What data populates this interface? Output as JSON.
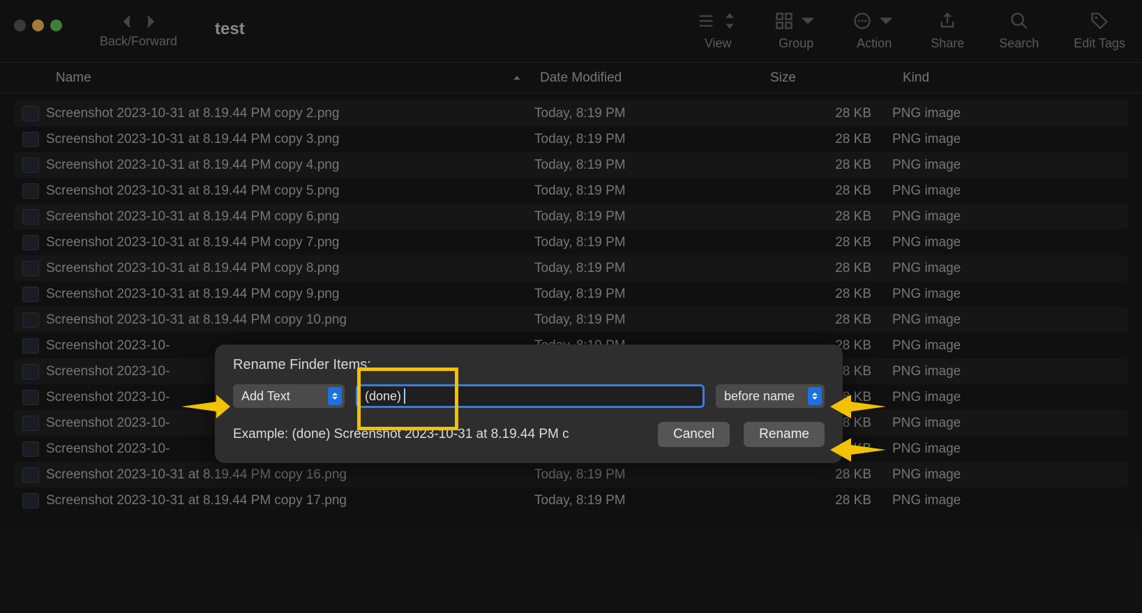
{
  "toolbar": {
    "nav_label": "Back/Forward",
    "title": "test",
    "view_label": "View",
    "group_label": "Group",
    "action_label": "Action",
    "share_label": "Share",
    "search_label": "Search",
    "tags_label": "Edit Tags"
  },
  "columns": {
    "name": "Name",
    "date": "Date Modified",
    "size": "Size",
    "kind": "Kind"
  },
  "date_value": "Today, 8:19 PM",
  "size_value": "28 KB",
  "kind_value": "PNG image",
  "files": [
    "Screenshot 2023-10-31 at 8.19.44 PM copy 2.png",
    "Screenshot 2023-10-31 at 8.19.44 PM copy 3.png",
    "Screenshot 2023-10-31 at 8.19.44 PM copy 4.png",
    "Screenshot 2023-10-31 at 8.19.44 PM copy 5.png",
    "Screenshot 2023-10-31 at 8.19.44 PM copy 6.png",
    "Screenshot 2023-10-31 at 8.19.44 PM copy 7.png",
    "Screenshot 2023-10-31 at 8.19.44 PM copy 8.png",
    "Screenshot 2023-10-31 at 8.19.44 PM copy 9.png",
    "Screenshot 2023-10-31 at 8.19.44 PM copy 10.png",
    "Screenshot 2023-10-",
    "Screenshot 2023-10-",
    "Screenshot 2023-10-",
    "Screenshot 2023-10-",
    "Screenshot 2023-10-",
    "Screenshot 2023-10-31 at 8.19.44 PM copy 16.png",
    "Screenshot 2023-10-31 at 8.19.44 PM copy 17.png"
  ],
  "dialog": {
    "title": "Rename Finder Items:",
    "mode": "Add Text",
    "text_value": "(done) ",
    "position": "before name",
    "example_label": "Example: (done) Screenshot 2023-10-31 at 8.19.44 PM c",
    "cancel": "Cancel",
    "rename": "Rename"
  }
}
